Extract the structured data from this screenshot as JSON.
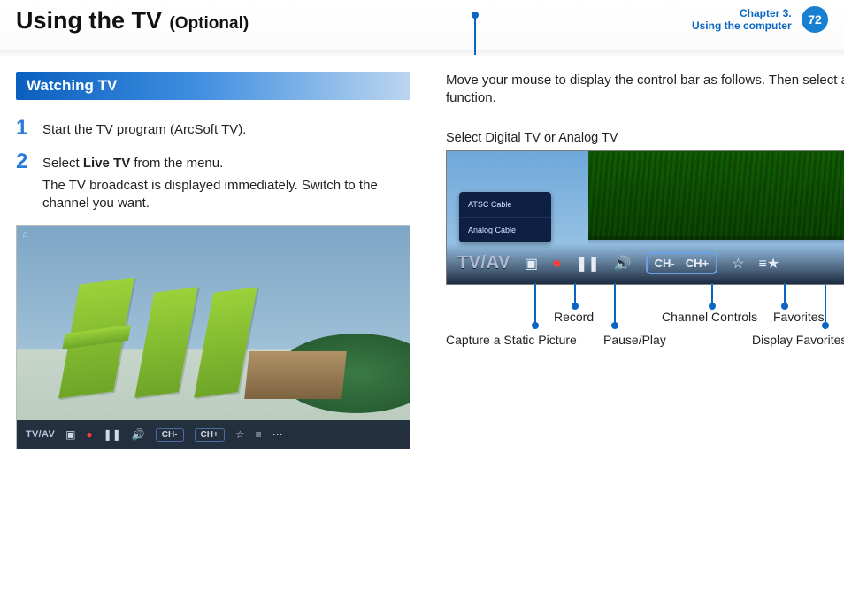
{
  "header": {
    "title_main": "Using the TV",
    "title_sub": "(Optional)",
    "chapter_line1": "Chapter 3.",
    "chapter_line2": "Using the computer",
    "page_number": "72"
  },
  "left": {
    "section_heading": "Watching TV",
    "steps": [
      {
        "num": "1",
        "text": "Start the TV program (ArcSoft TV)."
      },
      {
        "num": "2",
        "text_before": "Select ",
        "bold": "Live TV",
        "text_after": " from the menu.",
        "para2": "The TV broadcast is displayed immediately. Switch to the channel you want."
      }
    ],
    "shot_bar": {
      "tvav": "TV/AV",
      "ch_minus": "CH-",
      "ch_plus": "CH+"
    }
  },
  "right": {
    "intro": "Move your mouse to display the control bar as follows. Then select a function.",
    "top_caption": "Select Digital TV or Analog TV",
    "menu_items": [
      "ATSC Cable",
      "Analog Cable"
    ],
    "bar": {
      "tvav": "TV/AV",
      "ch_minus": "CH-",
      "ch_plus": "CH+"
    },
    "captions_row1": {
      "record": "Record",
      "channel_controls": "Channel Controls",
      "favorites": "Favorites"
    },
    "captions_row2": {
      "capture": "Capture a Static Picture",
      "pauseplay": "Pause/Play",
      "display_favorites": "Display Favorites"
    }
  }
}
